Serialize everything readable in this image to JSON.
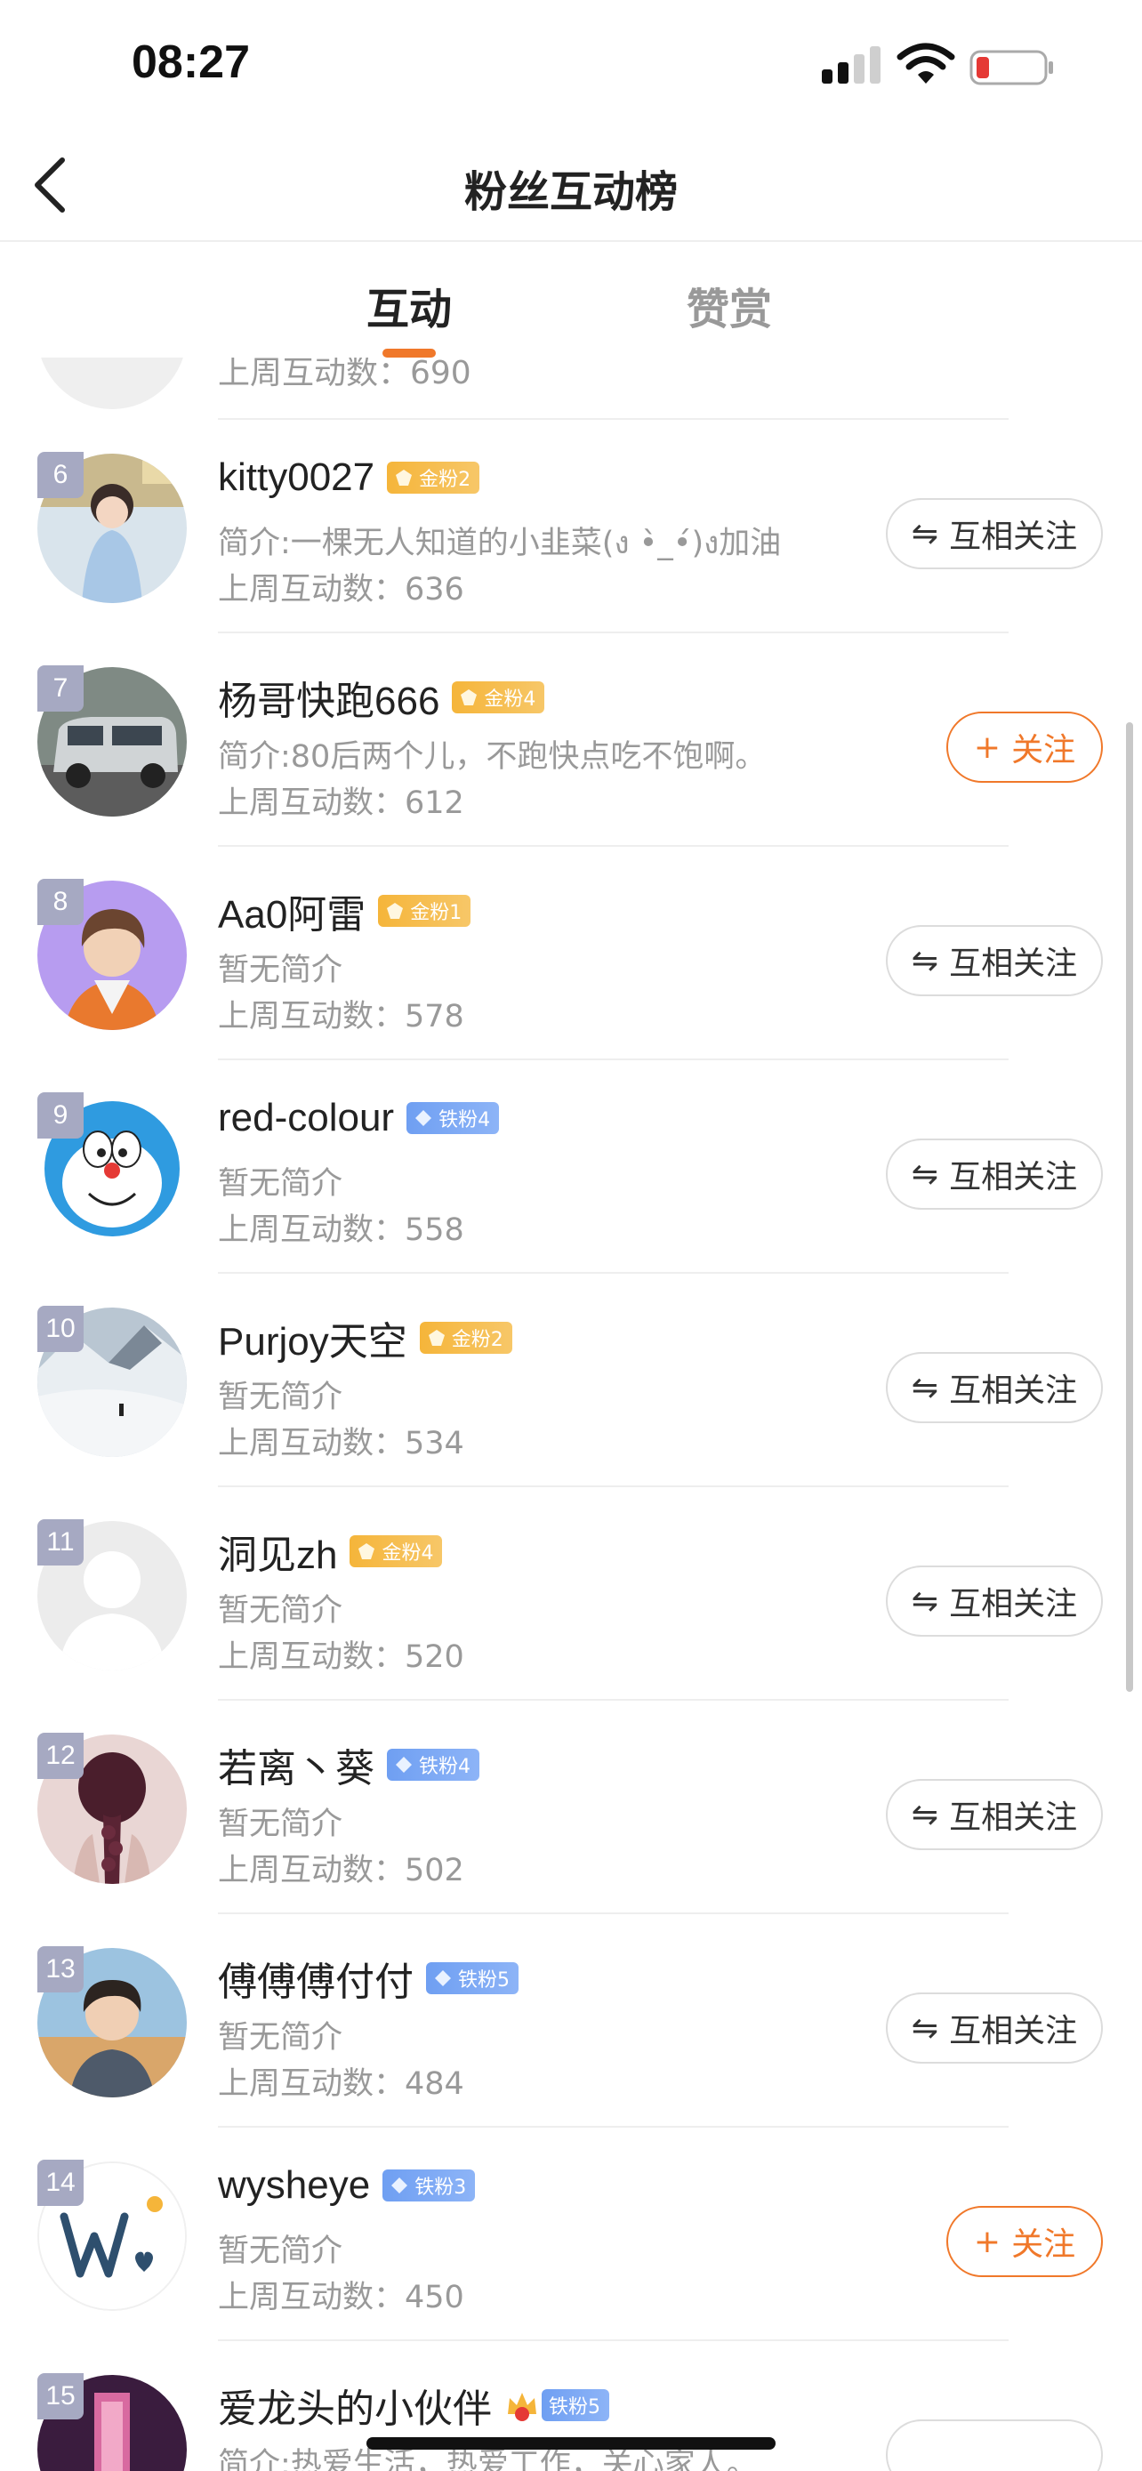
{
  "status_bar": {
    "time": "08:27"
  },
  "nav": {
    "title": "粉丝互动榜"
  },
  "tabs": {
    "interact": "互动",
    "reward": "赞赏"
  },
  "partial_row": {
    "stat": "上周互动数：690"
  },
  "rows": [
    {
      "rank": "6",
      "name": "kitty0027",
      "badge": "金粉2",
      "badge_type": "gold",
      "bio": "简介:一棵无人知道的小韭菜(ง •̀_•́)ง加油",
      "stat": "上周互动数：636",
      "button": "互相关注",
      "button_type": "mutual",
      "button_icon": "⇋"
    },
    {
      "rank": "7",
      "name": "杨哥快跑666",
      "badge": "金粉4",
      "badge_type": "gold",
      "bio": "简介:80后两个儿，不跑快点吃不饱啊。",
      "stat": "上周互动数：612",
      "button": "关注",
      "button_type": "follow",
      "button_icon": "+"
    },
    {
      "rank": "8",
      "name": "Aa0阿雷",
      "badge": "金粉1",
      "badge_type": "gold",
      "bio": "暂无简介",
      "stat": "上周互动数：578",
      "button": "互相关注",
      "button_type": "mutual",
      "button_icon": "⇋"
    },
    {
      "rank": "9",
      "name": "red-colour",
      "badge": "铁粉4",
      "badge_type": "iron",
      "bio": "暂无简介",
      "stat": "上周互动数：558",
      "button": "互相关注",
      "button_type": "mutual",
      "button_icon": "⇋"
    },
    {
      "rank": "10",
      "name": "Purjoy天空",
      "badge": "金粉2",
      "badge_type": "gold",
      "bio": "暂无简介",
      "stat": "上周互动数：534",
      "button": "互相关注",
      "button_type": "mutual",
      "button_icon": "⇋"
    },
    {
      "rank": "11",
      "name": "洞见zh",
      "badge": "金粉4",
      "badge_type": "gold",
      "bio": "暂无简介",
      "stat": "上周互动数：520",
      "button": "互相关注",
      "button_type": "mutual",
      "button_icon": "⇋"
    },
    {
      "rank": "12",
      "name": "若离丶葵",
      "badge": "铁粉4",
      "badge_type": "iron",
      "bio": "暂无简介",
      "stat": "上周互动数：502",
      "button": "互相关注",
      "button_type": "mutual",
      "button_icon": "⇋"
    },
    {
      "rank": "13",
      "name": "傅傅傅付付",
      "badge": "铁粉5",
      "badge_type": "iron",
      "bio": "暂无简介",
      "stat": "上周互动数：484",
      "button": "互相关注",
      "button_type": "mutual",
      "button_icon": "⇋"
    },
    {
      "rank": "14",
      "name": "wysheye",
      "badge": "铁粉3",
      "badge_type": "iron",
      "bio": "暂无简介",
      "stat": "上周互动数：450",
      "button": "关注",
      "button_type": "follow",
      "button_icon": "+"
    },
    {
      "rank": "15",
      "name": "爱龙头的小伙伴",
      "badge": "铁粉5",
      "badge_type": "iron",
      "bio": "简介:热爱生活，热爱工作，关心家人。",
      "stat": "",
      "button": "",
      "button_type": "mutual",
      "button_icon": ""
    }
  ],
  "colors": {
    "accent": "#f0782a",
    "gold_badge": "#f5b53a",
    "iron_badge": "#6f9ff2",
    "rank_bg": "#a6a9c2"
  }
}
